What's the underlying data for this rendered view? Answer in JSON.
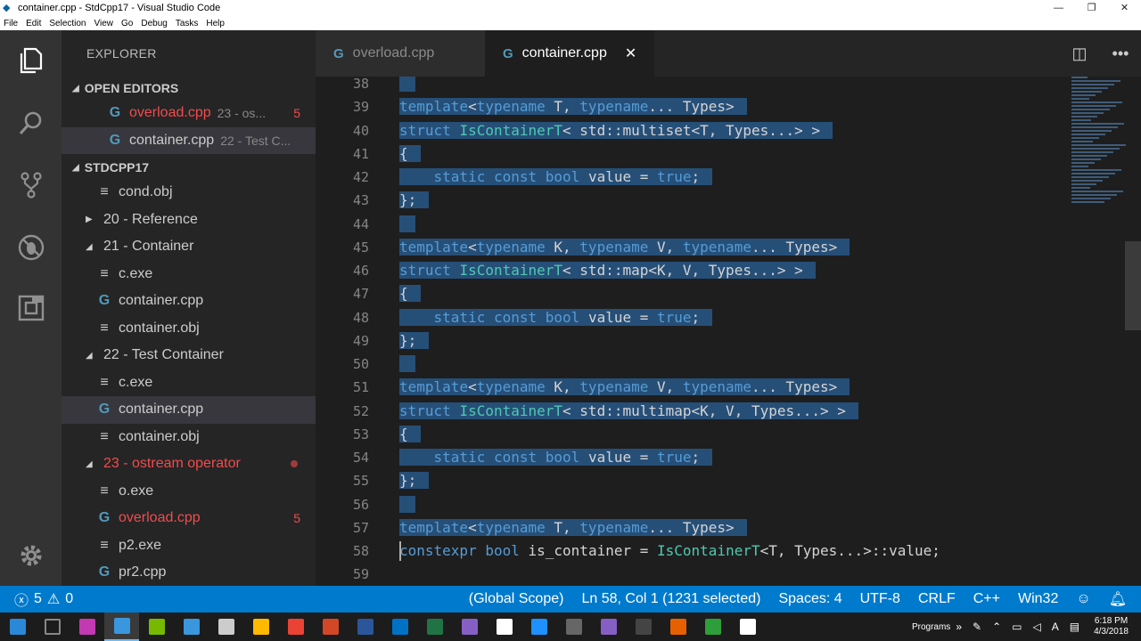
{
  "window": {
    "title": "container.cpp - StdCpp17 - Visual Studio Code",
    "controls": [
      "—",
      "❐",
      "✕"
    ]
  },
  "menu": [
    "File",
    "Edit",
    "Selection",
    "View",
    "Go",
    "Debug",
    "Tasks",
    "Help"
  ],
  "explorer": {
    "title": "EXPLORER",
    "open_editors_label": "OPEN EDITORS",
    "open_editors": [
      {
        "name": "overload.cpp",
        "desc": "23 - os...",
        "count": "5"
      },
      {
        "name": "container.cpp",
        "desc": "22 - Test C..."
      }
    ],
    "project_label": "STDCPP17",
    "tree": [
      {
        "label": "cond.obj",
        "kind": "file"
      },
      {
        "label": "20 - Reference",
        "kind": "folder-collapsed"
      },
      {
        "label": "21 - Container",
        "kind": "folder-open"
      },
      {
        "label": "c.exe",
        "kind": "file"
      },
      {
        "label": "container.cpp",
        "kind": "cpp"
      },
      {
        "label": "container.obj",
        "kind": "file"
      },
      {
        "label": "22 - Test Container",
        "kind": "folder-open"
      },
      {
        "label": "c.exe",
        "kind": "file"
      },
      {
        "label": "container.cpp",
        "kind": "cpp"
      },
      {
        "label": "container.obj",
        "kind": "file"
      },
      {
        "label": "23 - ostream operator",
        "kind": "folder-open"
      },
      {
        "label": "o.exe",
        "kind": "file"
      },
      {
        "label": "overload.cpp",
        "kind": "cpp",
        "count": "5"
      },
      {
        "label": "p2.exe",
        "kind": "file"
      },
      {
        "label": "pr2.cpp",
        "kind": "cpp"
      }
    ]
  },
  "tabs": [
    {
      "label": "overload.cpp",
      "active": false
    },
    {
      "label": "container.cpp",
      "active": true,
      "close": "✕"
    }
  ],
  "editor": {
    "line_numbers": [
      "38",
      "39",
      "40",
      "41",
      "42",
      "43",
      "44",
      "45",
      "46",
      "47",
      "48",
      "49",
      "50",
      "51",
      "52",
      "53",
      "54",
      "55",
      "56",
      "57",
      "58",
      "59"
    ],
    "lines": [
      "",
      "template<typename T, typename... Types>",
      "struct IsContainerT< std::multiset<T, Types...> >",
      "{",
      "    static const bool value = true;",
      "};",
      "",
      "template<typename K, typename V, typename... Types>",
      "struct IsContainerT< std::map<K, V, Types...> >",
      "{",
      "    static const bool value = true;",
      "};",
      "",
      "template<typename K, typename V, typename... Types>",
      "struct IsContainerT< std::multimap<K, V, Types...> >",
      "{",
      "    static const bool value = true;",
      "};",
      "",
      "template<typename T, typename... Types>",
      "constexpr bool is_container = IsContainerT<T, Types...>::value;",
      ""
    ]
  },
  "status": {
    "errors": "5",
    "warnings": "0",
    "scope": "(Global Scope)",
    "position": "Ln 58, Col 1 (1231 selected)",
    "spaces": "Spaces: 4",
    "encoding": "UTF-8",
    "eol": "CRLF",
    "language": "C++",
    "platform": "Win32"
  },
  "taskbar": {
    "programs_label": "Programs",
    "time": "6:18 PM",
    "date": "4/3/2018",
    "app_colors": [
      "#2b88d8",
      "#888888",
      "#c239b3",
      "#3a96dd",
      "#76b900",
      "#3a96dd",
      "#cccccc",
      "#ffb900",
      "#ea4335",
      "#d24726",
      "#2b579a",
      "#0072c6",
      "#217346",
      "#865fc5",
      "#ffffff",
      "#1e90ff",
      "#666666",
      "#865fc5",
      "#444444",
      "#e66000",
      "#2e9e3b",
      "#ffffff"
    ]
  },
  "colors": {
    "accent": "#007acc",
    "selection": "#264f78",
    "error": "#f14c4c",
    "keyword": "#569cd6",
    "type": "#4ec9b0"
  }
}
